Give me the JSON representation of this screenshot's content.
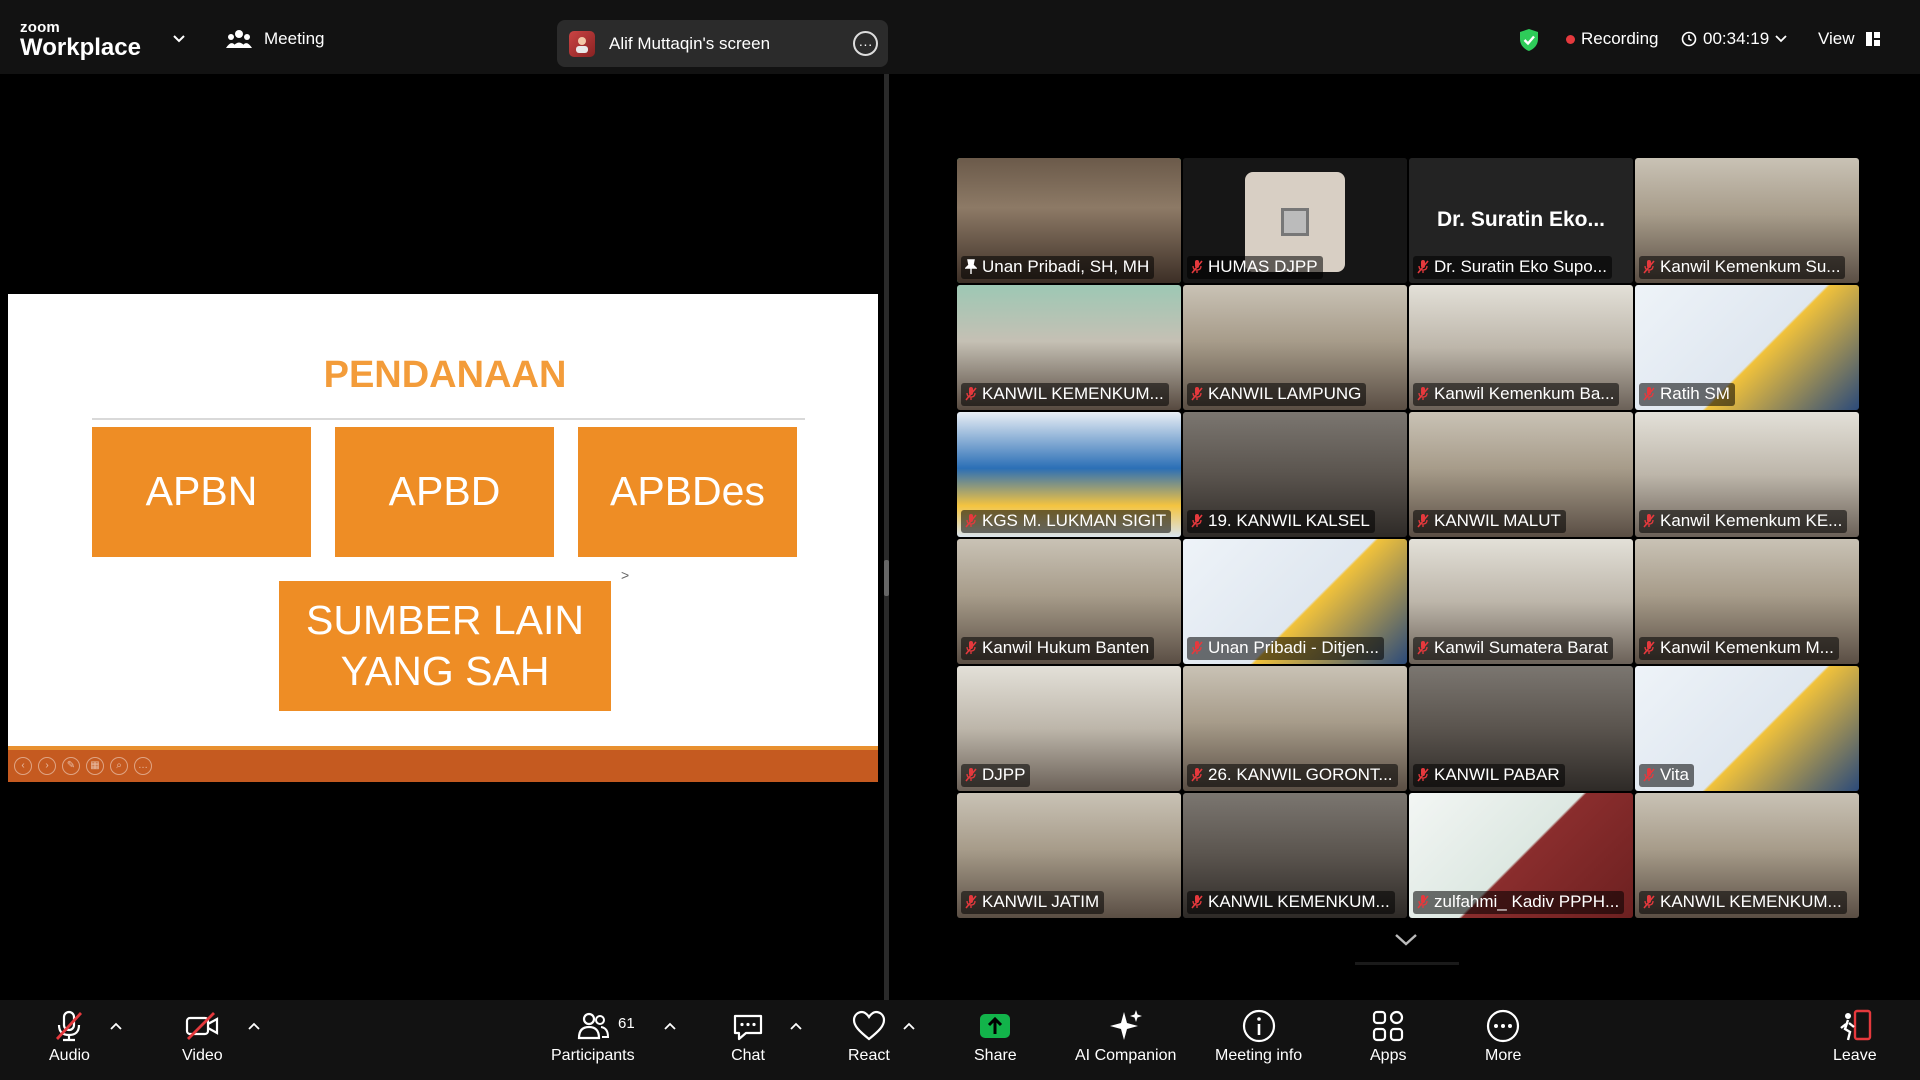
{
  "app": {
    "brand_line1": "zoom",
    "brand_line2": "Workplace",
    "meeting_label": "Meeting",
    "share_title": "Alif Muttaqin's screen",
    "recording_label": "Recording",
    "timer": "00:34:19",
    "view_label": "View"
  },
  "slide": {
    "title": "PENDANAAN",
    "boxes": [
      "APBN",
      "APBD",
      "APBDes"
    ],
    "box_wide_line1": "SUMBER LAIN",
    "box_wide_line2": "YANG SAH"
  },
  "gallery": {
    "tiles": [
      {
        "name": "Unan Pribadi, SH, MH",
        "pinned": true,
        "active": true,
        "scene": "person"
      },
      {
        "name": "HUMAS DJPP",
        "scene": "photo"
      },
      {
        "name": "Dr. Suratin Eko Supo...",
        "big_name": "Dr. Suratin Eko...",
        "scene": "dark"
      },
      {
        "name": "Kanwil Kemenkum Su...",
        "scene": "room"
      },
      {
        "name": "KANWIL KEMENKUM...",
        "scene": "room-green"
      },
      {
        "name": "KANWIL LAMPUNG",
        "scene": "room"
      },
      {
        "name": "Kanwil Kemenkum Ba...",
        "scene": "room-light"
      },
      {
        "name": "Ratih SM",
        "scene": "poster"
      },
      {
        "name": "KGS M. LUKMAN SIGIT",
        "scene": "banner"
      },
      {
        "name": "19. KANWIL KALSEL",
        "scene": "room-dark"
      },
      {
        "name": "KANWIL MALUT",
        "scene": "room"
      },
      {
        "name": "Kanwil Kemenkum KE...",
        "scene": "room-light"
      },
      {
        "name": "Kanwil Hukum Banten",
        "scene": "room"
      },
      {
        "name": "Unan Pribadi - Ditjen...",
        "scene": "poster"
      },
      {
        "name": "Kanwil Sumatera Barat",
        "scene": "room-light"
      },
      {
        "name": "Kanwil Kemenkum M...",
        "scene": "room"
      },
      {
        "name": "DJPP",
        "scene": "room-light"
      },
      {
        "name": "26. KANWIL GORONT...",
        "scene": "room"
      },
      {
        "name": "KANWIL PABAR",
        "scene": "room-dark"
      },
      {
        "name": "Vita",
        "scene": "poster"
      },
      {
        "name": "KANWIL  JATIM",
        "scene": "room"
      },
      {
        "name": "KANWIL KEMENKUM...",
        "scene": "room-dark"
      },
      {
        "name": "zulfahmi_ Kadiv PPPH...",
        "scene": "person-bps"
      },
      {
        "name": "KANWIL KEMENKUM...",
        "scene": "room"
      }
    ]
  },
  "toolbar": {
    "audio": "Audio",
    "video": "Video",
    "participants": "Participants",
    "participants_count": "61",
    "chat": "Chat",
    "react": "React",
    "share": "Share",
    "ai_companion": "AI Companion",
    "meeting_info": "Meeting info",
    "apps": "Apps",
    "more": "More",
    "leave": "Leave"
  },
  "colors": {
    "accent_green": "#23d18b",
    "recording_red": "#e5393d",
    "slide_orange": "#ee8d25",
    "leave_red": "#e5393d"
  }
}
